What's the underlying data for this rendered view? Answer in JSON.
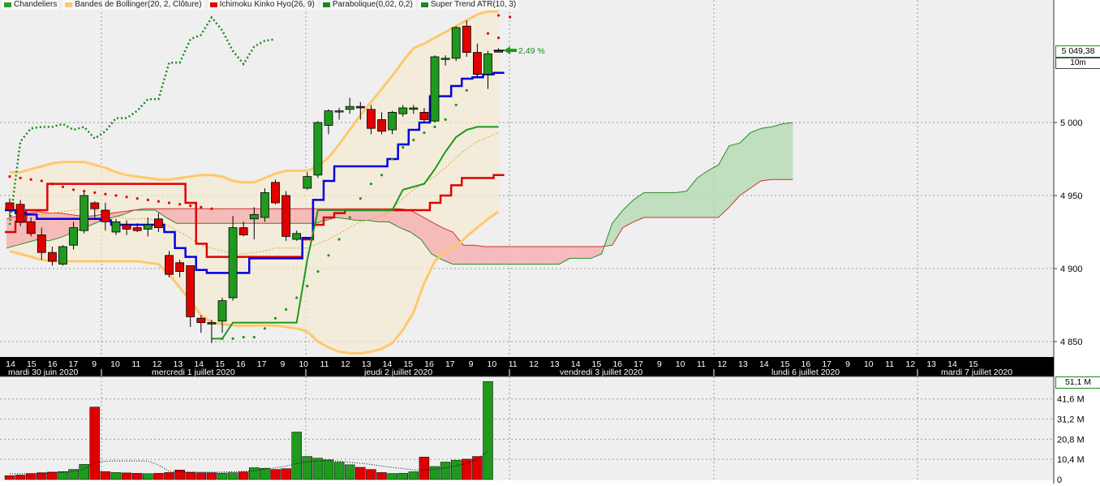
{
  "legend": [
    {
      "name": "Chandeliers",
      "color": "#2a9d2a"
    },
    {
      "name": "Bandes de Bollinger(20, 2, Clôture)",
      "color": "#ffc86b"
    },
    {
      "name": "Ichimoku Kinko Hyo(26, 9)",
      "color": "#e00000"
    },
    {
      "name": "Parabolique(0,02, 0,2)",
      "color": "#1a8a1a"
    },
    {
      "name": "Super Trend ATR(10, 3)",
      "color": "#1a8a1a"
    }
  ],
  "last_price": "5 049,38",
  "timeframe": "10m",
  "change_pct": "2,49 %",
  "volume_max_label": "51,1 M",
  "colors": {
    "up": "#1f9a1f",
    "down": "#e00000",
    "tenkan": "#0000e0",
    "kijun": "#e00000",
    "chikou": "#1a8a1a",
    "bollinger": "#ffc86b",
    "cloud_up": "#b7dcb5",
    "cloud_down": "#f4b3b3",
    "axis_bg": "#000000",
    "panel_bg": "#efefef"
  },
  "chart_data": [
    {
      "type": "candlestick",
      "y_ticks": [
        "5 000",
        "4 950",
        "4 900",
        "4 850"
      ],
      "y_tick_values": [
        5000,
        4950,
        4900,
        4850
      ],
      "ylim": [
        4844,
        5078
      ],
      "grid": true,
      "x_hour_labels": [
        "14",
        "15",
        "16",
        "17",
        "9",
        "10",
        "11",
        "12",
        "13",
        "14",
        "15",
        "16",
        "17",
        "9",
        "10",
        "11",
        "12",
        "13",
        "14",
        "15",
        "16",
        "17",
        "9",
        "10",
        "11",
        "12",
        "13",
        "14",
        "15",
        "16",
        "17",
        "9",
        "10",
        "11",
        "12",
        "13",
        "14",
        "15",
        "16",
        "17",
        "9",
        "10",
        "11",
        "12",
        "13",
        "14",
        "15"
      ],
      "x_day_labels": [
        "mardi 30 juin 2020",
        "mercredi 1 juillet 2020",
        "jeudi 2 juillet 2020",
        "vendredi 3 juillet 2020",
        "lundi 6 juillet 2020",
        "mardi 7 juillet 2020"
      ],
      "candles": [
        {
          "o": 4945,
          "h": 4948,
          "l": 4935,
          "c": 4940
        },
        {
          "o": 4944,
          "h": 4947,
          "l": 4929,
          "c": 4932
        },
        {
          "o": 4932,
          "h": 4935,
          "l": 4922,
          "c": 4924
        },
        {
          "o": 4923,
          "h": 4928,
          "l": 4906,
          "c": 4911
        },
        {
          "o": 4911,
          "h": 4915,
          "l": 4902,
          "c": 4905
        },
        {
          "o": 4903,
          "h": 4916,
          "l": 4902,
          "c": 4915
        },
        {
          "o": 4916,
          "h": 4932,
          "l": 4913,
          "c": 4928
        },
        {
          "o": 4926,
          "h": 4952,
          "l": 4924,
          "c": 4950
        },
        {
          "o": 4945,
          "h": 4946,
          "l": 4934,
          "c": 4941
        },
        {
          "o": 4940,
          "h": 4945,
          "l": 4926,
          "c": 4932
        },
        {
          "o": 4925,
          "h": 4934,
          "l": 4923,
          "c": 4932
        },
        {
          "o": 4930,
          "h": 4933,
          "l": 4923,
          "c": 4927
        },
        {
          "o": 4928,
          "h": 4931,
          "l": 4925,
          "c": 4926
        },
        {
          "o": 4927,
          "h": 4935,
          "l": 4922,
          "c": 4930
        },
        {
          "o": 4934,
          "h": 4938,
          "l": 4925,
          "c": 4928
        },
        {
          "o": 4909,
          "h": 4912,
          "l": 4894,
          "c": 4896
        },
        {
          "o": 4904,
          "h": 4906,
          "l": 4894,
          "c": 4898
        },
        {
          "o": 4902,
          "h": 4902,
          "l": 4860,
          "c": 4867
        },
        {
          "o": 4866,
          "h": 4868,
          "l": 4856,
          "c": 4863
        },
        {
          "o": 4863,
          "h": 4865,
          "l": 4849,
          "c": 4862
        },
        {
          "o": 4864,
          "h": 4880,
          "l": 4856,
          "c": 4878
        },
        {
          "o": 4880,
          "h": 4936,
          "l": 4878,
          "c": 4928
        },
        {
          "o": 4928,
          "h": 4932,
          "l": 4922,
          "c": 4923
        },
        {
          "o": 4934,
          "h": 4942,
          "l": 4920,
          "c": 4937
        },
        {
          "o": 4935,
          "h": 4955,
          "l": 4932,
          "c": 4952
        },
        {
          "o": 4959,
          "h": 4961,
          "l": 4944,
          "c": 4945
        },
        {
          "o": 4950,
          "h": 4953,
          "l": 4919,
          "c": 4922
        },
        {
          "o": 4920,
          "h": 4926,
          "l": 4919,
          "c": 4924
        },
        {
          "o": 4955,
          "h": 4966,
          "l": 4954,
          "c": 4963
        },
        {
          "o": 4964,
          "h": 5001,
          "l": 4962,
          "c": 5000
        },
        {
          "o": 4998,
          "h": 5009,
          "l": 4992,
          "c": 5008
        },
        {
          "o": 5008,
          "h": 5010,
          "l": 5002,
          "c": 5008
        },
        {
          "o": 5009,
          "h": 5017,
          "l": 5006,
          "c": 5011
        },
        {
          "o": 5011,
          "h": 5014,
          "l": 5002,
          "c": 5010
        },
        {
          "o": 5009,
          "h": 5012,
          "l": 4992,
          "c": 4996
        },
        {
          "o": 5002,
          "h": 5007,
          "l": 4992,
          "c": 4994
        },
        {
          "o": 4995,
          "h": 5008,
          "l": 4992,
          "c": 5007
        },
        {
          "o": 5006,
          "h": 5012,
          "l": 5004,
          "c": 5010
        },
        {
          "o": 5009,
          "h": 5012,
          "l": 5006,
          "c": 5010
        },
        {
          "o": 5007,
          "h": 5010,
          "l": 5000,
          "c": 5002
        },
        {
          "o": 5001,
          "h": 5046,
          "l": 5000,
          "c": 5045
        },
        {
          "o": 5044,
          "h": 5046,
          "l": 5039,
          "c": 5044
        },
        {
          "o": 5044,
          "h": 5066,
          "l": 5042,
          "c": 5065
        },
        {
          "o": 5066,
          "h": 5070,
          "l": 5045,
          "c": 5048
        },
        {
          "o": 5048,
          "h": 5054,
          "l": 5031,
          "c": 5033
        },
        {
          "o": 5033,
          "h": 5049,
          "l": 5023,
          "c": 5047
        },
        {
          "o": 5049,
          "h": 5051,
          "l": 5048,
          "c": 5049
        }
      ],
      "tenkan": [
        4940,
        4938,
        4937,
        4934,
        4934,
        4934,
        4934,
        4934,
        4934,
        4933,
        4930,
        4930,
        4930,
        4930,
        4930,
        4925,
        4914,
        4908,
        4899,
        4897,
        4897,
        4897,
        4897,
        4907,
        4907,
        4907,
        4907,
        4907,
        4921,
        4947,
        4960,
        4970,
        4970,
        4970,
        4970,
        4970,
        4975,
        4985,
        4995,
        5000,
        5018,
        5018,
        5025,
        5030,
        5031,
        5033,
        5034
      ],
      "kijun": [
        4925,
        4932,
        4940,
        4940,
        4958,
        4958,
        4958,
        4958,
        4958,
        4958,
        4958,
        4958,
        4958,
        4958,
        4958,
        4958,
        4958,
        4945,
        4917,
        4908,
        4908,
        4908,
        4908,
        4908,
        4908,
        4908,
        4908,
        4908,
        4920,
        4930,
        4935,
        4938,
        4940,
        4940,
        4940,
        4940,
        4940,
        4940,
        4940,
        4940,
        4945,
        4950,
        4957,
        4962,
        4962,
        4962,
        4964
      ],
      "chikou": [
        4930,
        4987,
        4996,
        4997,
        4997,
        4999,
        4995,
        4997,
        4989,
        4994,
        5003,
        5003,
        5008,
        5016,
        5016,
        5041,
        5041,
        5057,
        5060,
        5072,
        5063,
        5049,
        5040,
        5052,
        5056,
        5057
      ],
      "cloud": [
        {
          "a": 4914,
          "b": 4934
        },
        {
          "a": 4916,
          "b": 4936
        },
        {
          "a": 4918,
          "b": 4938
        },
        {
          "a": 4920,
          "b": 4939
        },
        {
          "a": 4919,
          "b": 4938
        },
        {
          "a": 4921,
          "b": 4938
        },
        {
          "a": 4924,
          "b": 4937
        },
        {
          "a": 4927,
          "b": 4936
        },
        {
          "a": 4930,
          "b": 4936
        },
        {
          "a": 4933,
          "b": 4937
        },
        {
          "a": 4935,
          "b": 4938
        },
        {
          "a": 4937,
          "b": 4939
        },
        {
          "a": 4940,
          "b": 4940
        },
        {
          "a": 4940,
          "b": 4941
        },
        {
          "a": 4940,
          "b": 4941
        },
        {
          "a": 4935,
          "b": 4941
        },
        {
          "a": 4931,
          "b": 4941
        },
        {
          "a": 4931,
          "b": 4941
        },
        {
          "a": 4931,
          "b": 4941
        },
        {
          "a": 4931,
          "b": 4941
        },
        {
          "a": 4931,
          "b": 4941
        },
        {
          "a": 4931,
          "b": 4941
        },
        {
          "a": 4931,
          "b": 4941
        },
        {
          "a": 4931,
          "b": 4941
        },
        {
          "a": 4931,
          "b": 4941
        },
        {
          "a": 4931,
          "b": 4941
        },
        {
          "a": 4931,
          "b": 4941
        },
        {
          "a": 4931,
          "b": 4941
        },
        {
          "a": 4931,
          "b": 4941
        },
        {
          "a": 4931,
          "b": 4941
        },
        {
          "a": 4933,
          "b": 4941
        },
        {
          "a": 4935,
          "b": 4941
        },
        {
          "a": 4934,
          "b": 4941
        },
        {
          "a": 4933,
          "b": 4941
        },
        {
          "a": 4933,
          "b": 4941
        },
        {
          "a": 4932,
          "b": 4941
        },
        {
          "a": 4932,
          "b": 4941
        },
        {
          "a": 4928,
          "b": 4941
        },
        {
          "a": 4925,
          "b": 4940
        },
        {
          "a": 4920,
          "b": 4936
        },
        {
          "a": 4910,
          "b": 4932
        },
        {
          "a": 4906,
          "b": 4928
        },
        {
          "a": 4903,
          "b": 4925
        },
        {
          "a": 4903,
          "b": 4916
        },
        {
          "a": 4903,
          "b": 4916
        },
        {
          "a": 4903,
          "b": 4915
        },
        {
          "a": 4903,
          "b": 4915
        },
        {
          "a": 4903,
          "b": 4915
        },
        {
          "a": 4903,
          "b": 4915
        },
        {
          "a": 4903,
          "b": 4915
        },
        {
          "a": 4903,
          "b": 4915
        },
        {
          "a": 4903,
          "b": 4915
        },
        {
          "a": 4903,
          "b": 4915
        },
        {
          "a": 4907,
          "b": 4915
        },
        {
          "a": 4907,
          "b": 4915
        },
        {
          "a": 4907,
          "b": 4915
        },
        {
          "a": 4910,
          "b": 4915
        },
        {
          "a": 4931,
          "b": 4916
        },
        {
          "a": 4940,
          "b": 4928
        },
        {
          "a": 4947,
          "b": 4932
        },
        {
          "a": 4952,
          "b": 4935
        },
        {
          "a": 4952,
          "b": 4935
        },
        {
          "a": 4952,
          "b": 4935
        },
        {
          "a": 4952,
          "b": 4935
        },
        {
          "a": 4953,
          "b": 4935
        },
        {
          "a": 4962,
          "b": 4935
        },
        {
          "a": 4967,
          "b": 4935
        },
        {
          "a": 4971,
          "b": 4935
        },
        {
          "a": 4984,
          "b": 4942
        },
        {
          "a": 4986,
          "b": 4950
        },
        {
          "a": 4993,
          "b": 4955
        },
        {
          "a": 4996,
          "b": 4960
        },
        {
          "a": 4997,
          "b": 4961
        },
        {
          "a": 4999,
          "b": 4961
        },
        {
          "a": 5000,
          "b": 4961
        }
      ],
      "bollinger_upper": [
        4966,
        4966,
        4968,
        4970,
        4972,
        4973,
        4973,
        4973,
        4971,
        4969,
        4966,
        4964,
        4963,
        4962,
        4961,
        4961,
        4962,
        4963,
        4964,
        4964,
        4963,
        4960,
        4959,
        4959,
        4962,
        4965,
        4967,
        4967,
        4967,
        4970,
        4976,
        4985,
        4995,
        5005,
        5014,
        5023,
        5032,
        5042,
        5051,
        5054,
        5058,
        5062,
        5066,
        5070,
        5074,
        5076,
        5076
      ],
      "bollinger_lower": [
        4912,
        4910,
        4908,
        4906,
        4905,
        4905,
        4905,
        4905,
        4905,
        4905,
        4905,
        4905,
        4905,
        4904,
        4903,
        4896,
        4887,
        4878,
        4868,
        4863,
        4862,
        4861,
        4861,
        4861,
        4861,
        4861,
        4860,
        4859,
        4857,
        4850,
        4846,
        4843,
        4842,
        4842,
        4843,
        4845,
        4849,
        4858,
        4870,
        4890,
        4905,
        4912,
        4915,
        4922,
        4928,
        4934,
        4939
      ],
      "bollinger_mid": [
        4940,
        4938,
        4937,
        4937,
        4938,
        4939,
        4940,
        4941,
        4940,
        4938,
        4936,
        4934,
        4934,
        4934,
        4933,
        4929,
        4925,
        4921,
        4916,
        4914,
        4912,
        4910,
        4910,
        4911,
        4912,
        4914,
        4914,
        4914,
        4914,
        4917,
        4920,
        4924,
        4928,
        4932,
        4934,
        4936,
        4941,
        4948,
        4954,
        4959,
        4963,
        4969,
        4976,
        4982,
        4987,
        4990,
        4993
      ],
      "parabolic": [
        4963,
        4962,
        4961,
        4960,
        4958,
        4956,
        4954,
        4953,
        4952,
        4951,
        4950,
        4949,
        4948,
        4947,
        4946,
        4945,
        4944,
        4943,
        4942,
        4941,
        4852,
        4852,
        4853,
        4853,
        4859,
        4866,
        4872,
        4880,
        4888,
        4898,
        4909,
        4920,
        4935,
        4948,
        4958,
        4964,
        4975,
        4983,
        4988,
        4993,
        4997,
        5002,
        5012,
        5022,
        5033,
        5061,
        5058
      ],
      "supertrend": [
        {
          "i": 19,
          "v": 4852
        },
        {
          "i": 20,
          "v": 4852
        },
        {
          "i": 21,
          "v": 4863
        },
        {
          "i": 22,
          "v": 4863
        },
        {
          "i": 23,
          "v": 4863
        },
        {
          "i": 24,
          "v": 4863
        },
        {
          "i": 25,
          "v": 4863
        },
        {
          "i": 26,
          "v": 4863
        },
        {
          "i": 27,
          "v": 4863
        },
        {
          "i": 28,
          "v": 4906
        },
        {
          "i": 29,
          "v": 4940
        },
        {
          "i": 30,
          "v": 4940
        },
        {
          "i": 31,
          "v": 4940
        },
        {
          "i": 32,
          "v": 4940
        },
        {
          "i": 33,
          "v": 4940
        },
        {
          "i": 34,
          "v": 4940
        },
        {
          "i": 35,
          "v": 4940
        },
        {
          "i": 36,
          "v": 4940
        },
        {
          "i": 37,
          "v": 4954
        },
        {
          "i": 38,
          "v": 4956
        },
        {
          "i": 39,
          "v": 4958
        },
        {
          "i": 40,
          "v": 4968
        },
        {
          "i": 41,
          "v": 4980
        },
        {
          "i": 42,
          "v": 4990
        },
        {
          "i": 43,
          "v": 4995
        },
        {
          "i": 44,
          "v": 4997
        },
        {
          "i": 45,
          "v": 4997
        },
        {
          "i": 46,
          "v": 4997
        }
      ]
    },
    {
      "type": "bar",
      "series_label": "Volume",
      "y_ticks": [
        "41,6 M",
        "31,2 M",
        "20,8 M",
        "10,4 M",
        "0"
      ],
      "y_tick_values": [
        41.6,
        31.2,
        20.8,
        10.4,
        0
      ],
      "ylim": [
        0,
        51.1
      ],
      "volumes": [
        2.0,
        2.3,
        3.0,
        3.5,
        3.8,
        4.1,
        5.2,
        7.8,
        37.4,
        4.1,
        3.6,
        3.4,
        3.2,
        3.0,
        3.2,
        3.6,
        4.9,
        3.7,
        3.5,
        3.5,
        3.3,
        3.5,
        3.9,
        6.1,
        5.8,
        5.2,
        5.6,
        24.5,
        11.9,
        11.0,
        10.2,
        8.9,
        7.6,
        6.3,
        5.2,
        3.6,
        3.1,
        3.2,
        4.0,
        11.6,
        6.7,
        9.0,
        10.0,
        10.5,
        11.9,
        50.6
      ],
      "volume_ma": [
        3.0,
        3.0,
        3.1,
        3.3,
        3.5,
        3.8,
        4.2,
        5.4,
        8.9,
        9.4,
        9.6,
        9.6,
        9.6,
        9.5,
        7.5,
        4.2,
        4.0,
        3.9,
        3.8,
        3.8,
        3.8,
        4.0,
        4.2,
        4.5,
        5.5,
        6.0,
        7.0,
        8.3,
        9.1,
        9.6,
        9.7,
        9.4,
        8.9,
        8.4,
        7.8,
        7.0,
        6.2,
        5.6,
        5.0,
        4.9,
        5.3,
        5.9,
        7.1,
        8.4,
        10.6,
        14.7
      ]
    }
  ]
}
